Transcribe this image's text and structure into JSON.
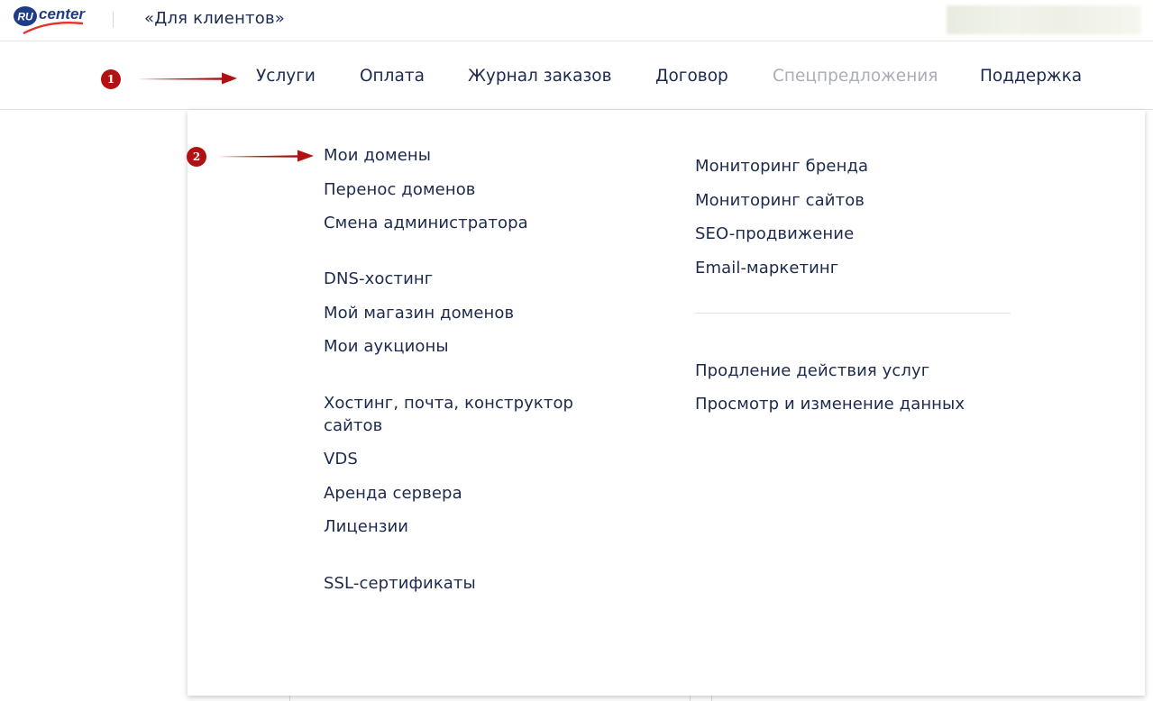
{
  "header": {
    "logo_text_ru": "RU",
    "logo_text_center": "center",
    "title": "«Для клиентов»"
  },
  "nav": {
    "items": [
      {
        "label": "Услуги",
        "state": "active"
      },
      {
        "label": "Оплата",
        "state": "normal"
      },
      {
        "label": "Журнал заказов",
        "state": "normal"
      },
      {
        "label": "Договор",
        "state": "normal"
      },
      {
        "label": "Спецпредложения",
        "state": "disabled"
      },
      {
        "label": "Поддержка",
        "state": "normal"
      }
    ]
  },
  "annotations": {
    "marker1": "1",
    "marker2": "2"
  },
  "dropdown": {
    "left_column": [
      "Мои домены",
      "Перенос доменов",
      "Смена администратора",
      "DNS-хостинг",
      "Мой магазин доменов",
      "Мои аукционы",
      "Хостинг, почта, конструктор сайтов",
      "VDS",
      "Аренда сервера",
      "Лицензии",
      "SSL-сертификаты"
    ],
    "right_column": [
      "Мониторинг бренда",
      "Мониторинг сайтов",
      "SEO-продвижение",
      "Email-маркетинг",
      "Продление действия услуг",
      "Просмотр и изменение данных"
    ]
  },
  "colors": {
    "text": "#1d2a4d",
    "disabled": "#a9aeb9",
    "annotation_red": "#b01213",
    "logo_blue": "#1f3c88",
    "logo_red": "#e4322b"
  }
}
